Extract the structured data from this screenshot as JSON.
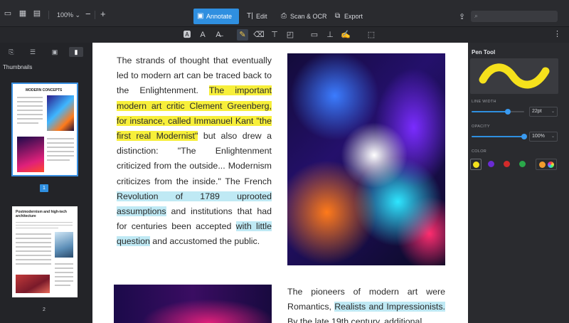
{
  "toolbar": {
    "zoom": "100%",
    "zoom_chevron": "⌄",
    "zoom_minus": "−",
    "zoom_plus": "+",
    "modes": {
      "annotate": "Annotate",
      "edit": "Edit",
      "scan": "Scan & OCR",
      "export": "Export"
    },
    "mode_icons": {
      "annotate": "▣",
      "edit": "T|",
      "scan": "⎙",
      "export": "⧉"
    },
    "active_mode": "annotate"
  },
  "sidebar": {
    "title": "Thumbnails",
    "pages": [
      {
        "number": "1",
        "title": "MODERN CONCEPTS",
        "selected": true
      },
      {
        "number": "2",
        "title": "Postmodernism and high-tech architecture",
        "selected": false
      }
    ]
  },
  "document": {
    "para1": [
      {
        "text": "The strands of thought that eventually led to modern art can be traced back to the Enlightenment. ",
        "hl": "none"
      },
      {
        "text": "The important modern art critic Clement Greenberg, for instance, called Immanuel Kant \"the first real Modernist\"",
        "hl": "yellow"
      },
      {
        "text": " but also drew a distinction: \"The Enlightenment criticized from the outside... Modernism criticizes from the inside.\" The French ",
        "hl": "none"
      },
      {
        "text": "Revolution of 1789 uprooted assumptions",
        "hl": "blue"
      },
      {
        "text": " and institutions that had for centuries been accepted ",
        "hl": "none"
      },
      {
        "text": "with little question",
        "hl": "blue"
      },
      {
        "text": " and accustomed the public.",
        "hl": "none"
      }
    ],
    "para2": [
      {
        "text": "The pioneers of modern art were Romantics, ",
        "hl": "none"
      },
      {
        "text": "Realists and Impressionists.",
        "hl": "blue"
      },
      {
        "text": " By the late 19th century, additional",
        "hl": "none"
      }
    ]
  },
  "panel": {
    "title": "Pen Tool",
    "line_width_label": "LINE WIDTH",
    "line_width_value": "22pt",
    "line_width_fraction": 0.69,
    "opacity_label": "OPACITY",
    "opacity_value": "100%",
    "opacity_fraction": 1.0,
    "color_label": "COLOR",
    "stroke_color": "#f5e11c",
    "colors": [
      "#f5e11c",
      "#6a2bd3",
      "#d22a2a",
      "#2aa84a",
      "#f39c2c"
    ],
    "selected_color": "#f5e11c"
  },
  "accent_color": "#2f8fe0",
  "highlight_yellow": "#f7ef3a",
  "highlight_blue": "#bfe9f4"
}
